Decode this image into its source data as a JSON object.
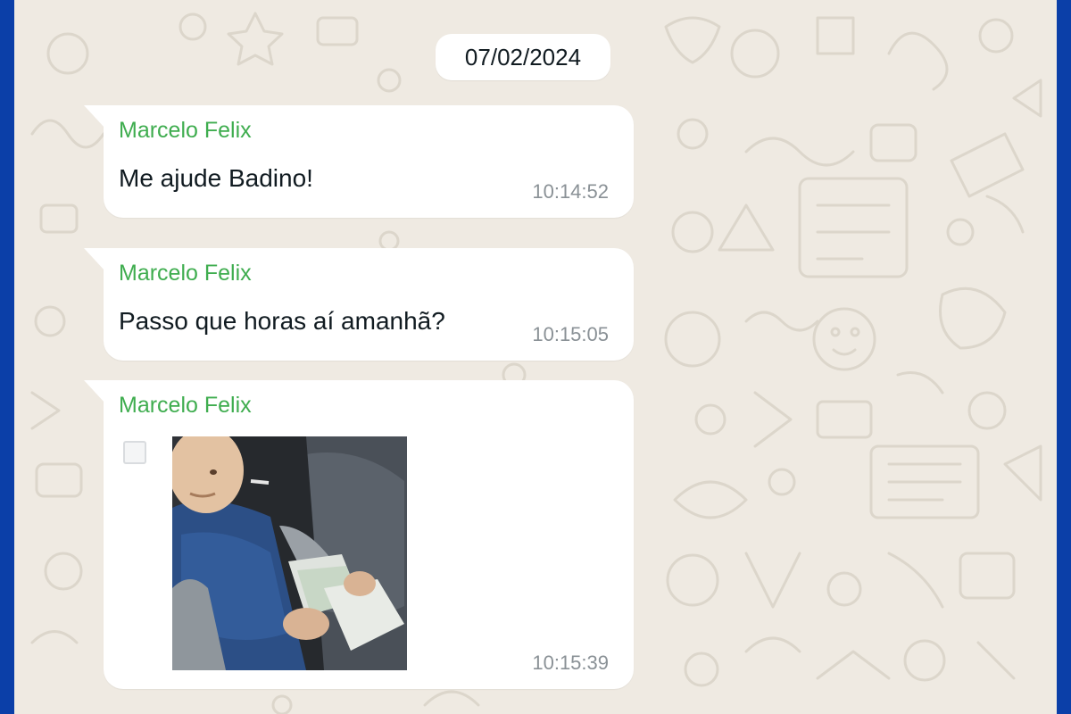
{
  "date_separator": "07/02/2024",
  "messages": [
    {
      "sender": "Marcelo Felix",
      "text": "Me ajude Badino!",
      "time": "10:14:52"
    },
    {
      "sender": "Marcelo Felix",
      "text": "Passo que horas aí amanhã?",
      "time": "10:15:05"
    },
    {
      "sender": "Marcelo Felix",
      "media": "gif-image",
      "time": "10:15:39"
    }
  ],
  "colors": {
    "frame": "#0b3fa8",
    "chat_background": "#efeae2",
    "bubble": "#ffffff",
    "sender_name": "#3fad4f",
    "timestamp": "#8a9196"
  }
}
